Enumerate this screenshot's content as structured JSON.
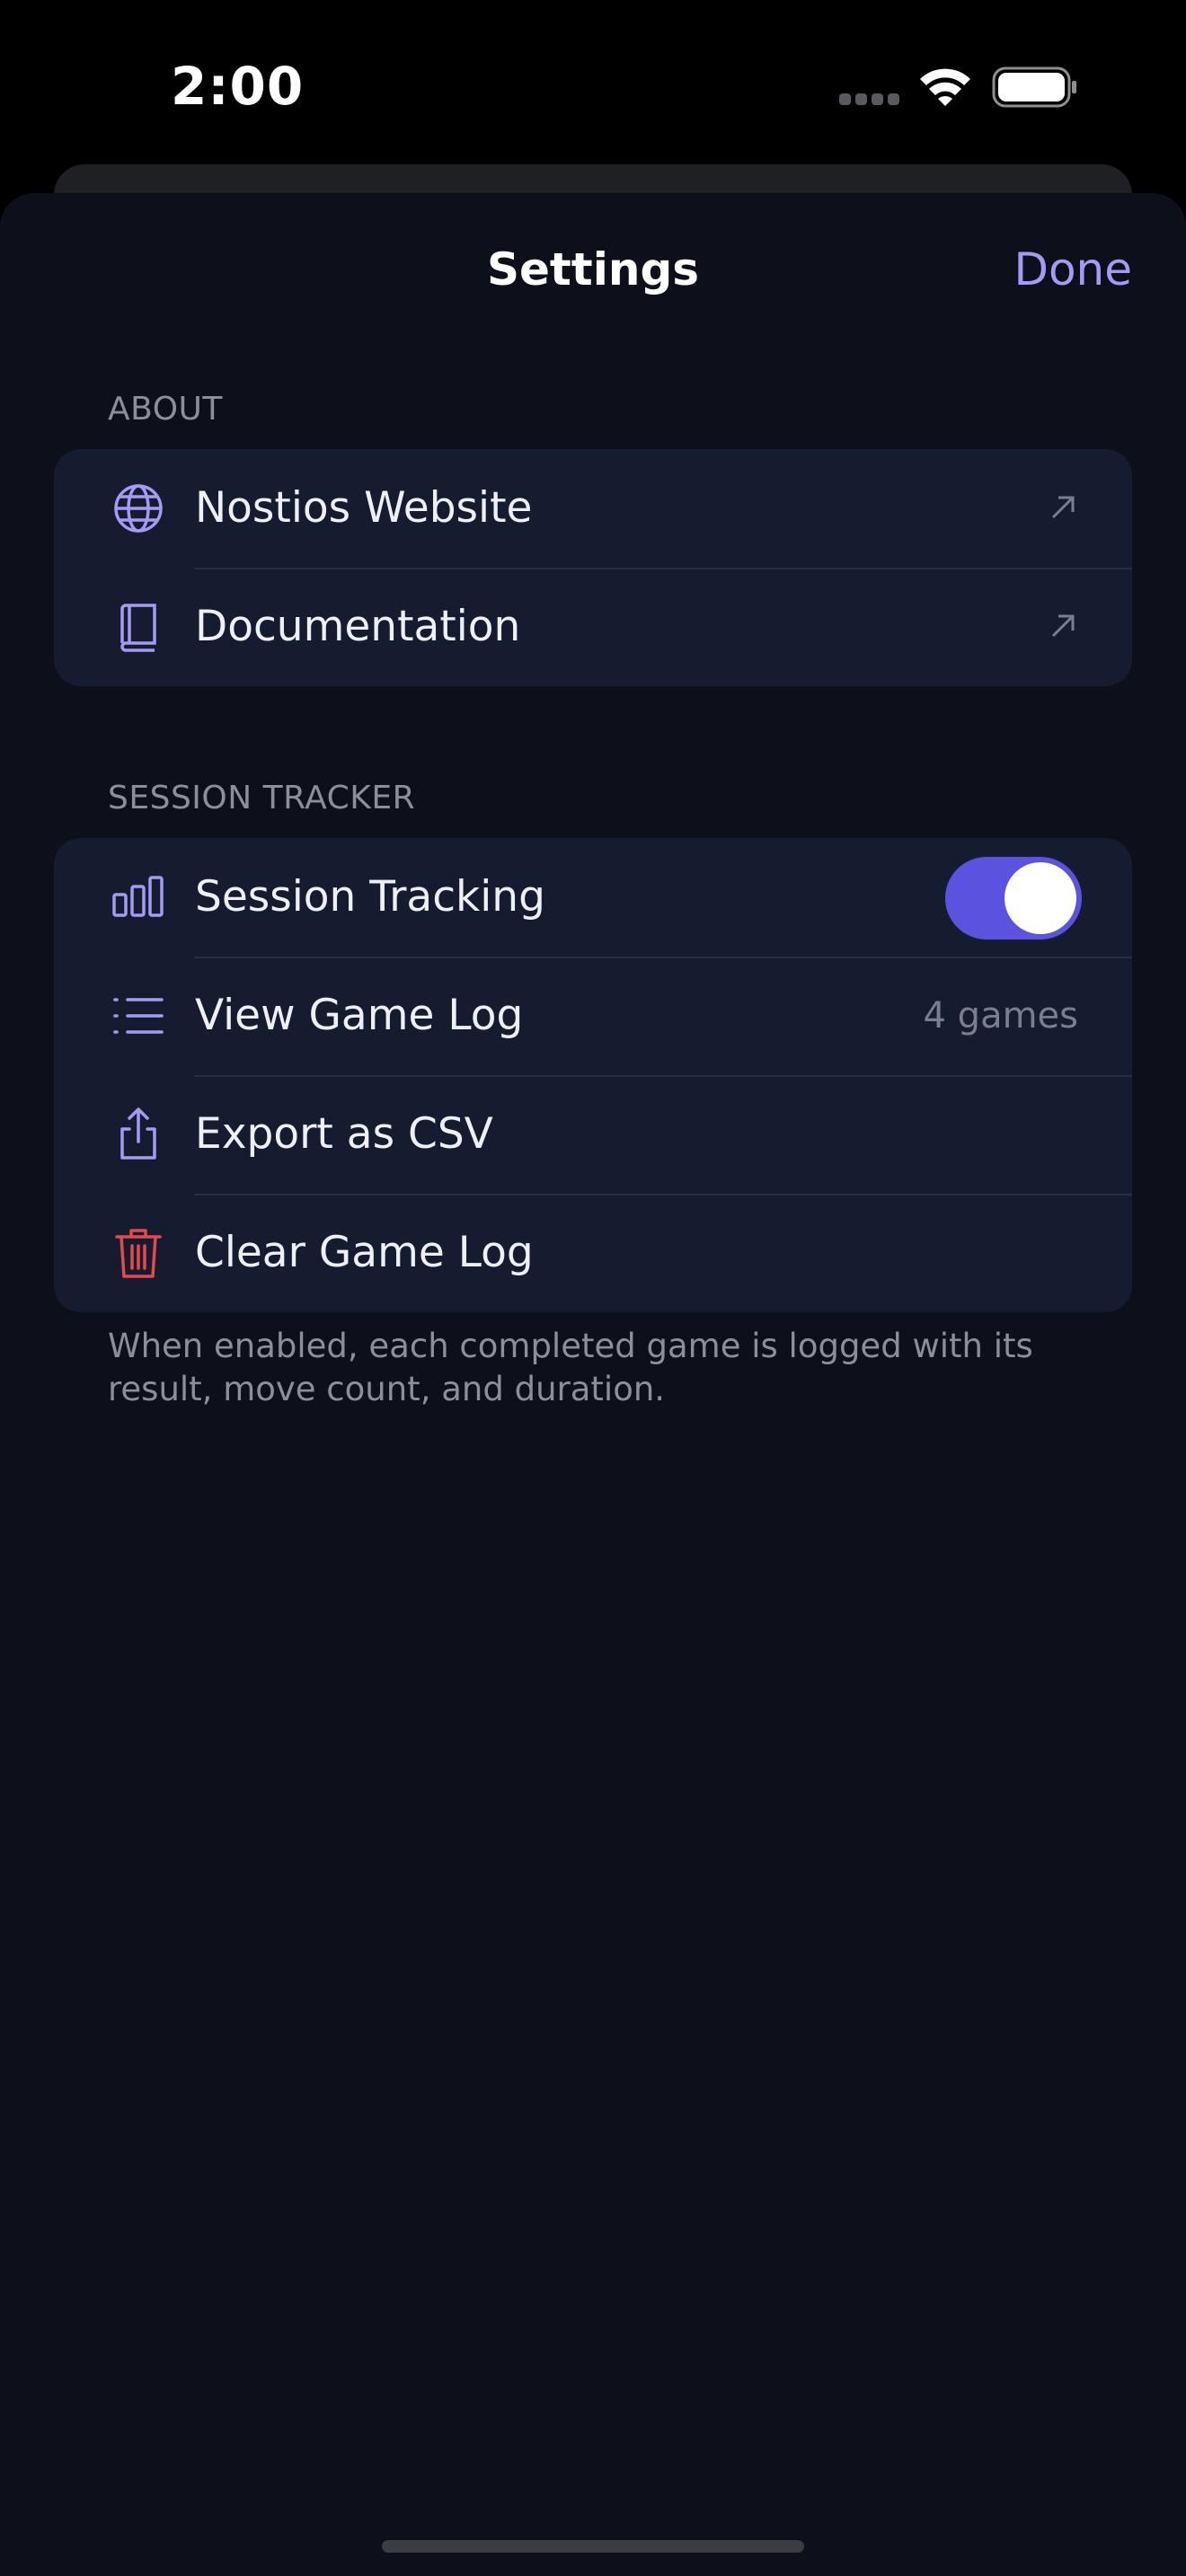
{
  "status_bar": {
    "time": "2:00"
  },
  "nav": {
    "title": "Settings",
    "done_label": "Done"
  },
  "about": {
    "header": "ABOUT",
    "items": [
      {
        "label": "Nostios Website",
        "icon": "globe-icon"
      },
      {
        "label": "Documentation",
        "icon": "book-icon"
      }
    ]
  },
  "session_tracker": {
    "header": "SESSION TRACKER",
    "items": [
      {
        "label": "Session Tracking",
        "icon": "bar-chart-icon",
        "toggle_on": true
      },
      {
        "label": "View Game Log",
        "icon": "list-icon",
        "value": "4 games"
      },
      {
        "label": "Export as CSV",
        "icon": "share-icon"
      },
      {
        "label": "Clear Game Log",
        "icon": "trash-icon"
      }
    ],
    "footer": "When enabled, each completed game is logged with its result, move count, and duration."
  },
  "colors": {
    "accent": "#a59bf5",
    "toggle_on": "#5b52e0",
    "destructive": "#e5484d",
    "sheet_background": "#0d0f1a",
    "group_background": "#161c30"
  }
}
